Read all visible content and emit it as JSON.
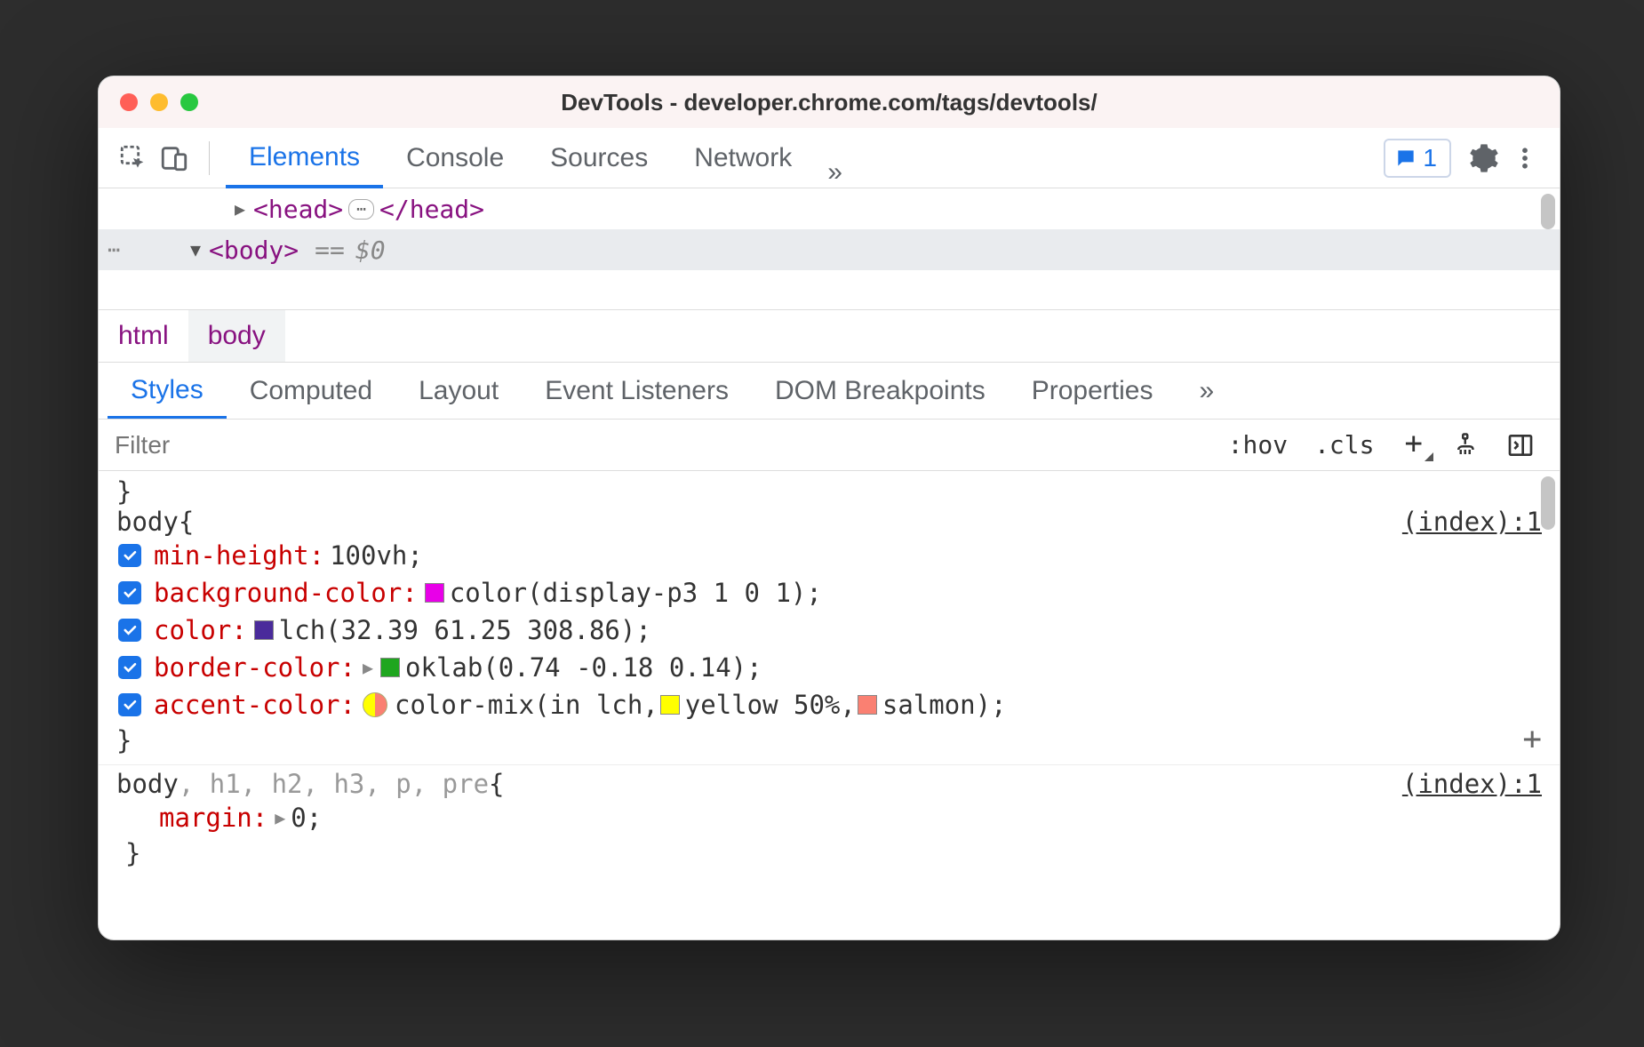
{
  "window": {
    "title": "DevTools - developer.chrome.com/tags/devtools/"
  },
  "toolbar": {
    "tabs": [
      "Elements",
      "Console",
      "Sources",
      "Network"
    ],
    "active_tab": "Elements",
    "overflow": "»",
    "issue_count": "1"
  },
  "dom": {
    "head_open": "<head>",
    "head_ellipsis": "⋯",
    "head_close": "</head>",
    "body_open": "<body>",
    "eq": "==",
    "dollar": "$0",
    "left_dots": "⋯"
  },
  "breadcrumbs": [
    "html",
    "body"
  ],
  "styles_tabs": {
    "items": [
      "Styles",
      "Computed",
      "Layout",
      "Event Listeners",
      "DOM Breakpoints",
      "Properties"
    ],
    "active": "Styles",
    "overflow": "»"
  },
  "styles_toolbar": {
    "filter_placeholder": "Filter",
    "hov": ":hov",
    "cls": ".cls",
    "plus": "+"
  },
  "rules": {
    "prev_close": "}",
    "rule1": {
      "selector": "body",
      "open": "{",
      "source": "(index):1",
      "props": [
        {
          "name": "min-height",
          "value_plain": "100vh"
        },
        {
          "name": "background-color",
          "swatch": "#e800e8",
          "value_plain": "color(display-p3 1 0 1)"
        },
        {
          "name": "color",
          "swatch": "#4a2b9b",
          "value_plain": "lch(32.39 61.25 308.86)"
        },
        {
          "name": "border-color",
          "expand": true,
          "swatch": "#1fa61f",
          "value_plain": "oklab(0.74 -0.18 0.14)"
        },
        {
          "name": "accent-color",
          "mix": true,
          "pre": "color-mix(in lch,",
          "arg1_swatch": "#ffff00",
          "arg1_text": "yellow 50%",
          "arg2_swatch": "#fa8072",
          "arg2_text": "salmon",
          "post": ")"
        }
      ],
      "close": "}",
      "add": "+"
    },
    "rule2": {
      "selector_main": "body",
      "selector_dim": ", h1, h2, h3, p, pre",
      "open": "{",
      "source": "(index):1",
      "prop": {
        "name": "margin",
        "expand": true,
        "value_plain": "0"
      },
      "close": "}"
    }
  },
  "punct": {
    "colon": ":",
    "semi": ";",
    "space": " "
  }
}
